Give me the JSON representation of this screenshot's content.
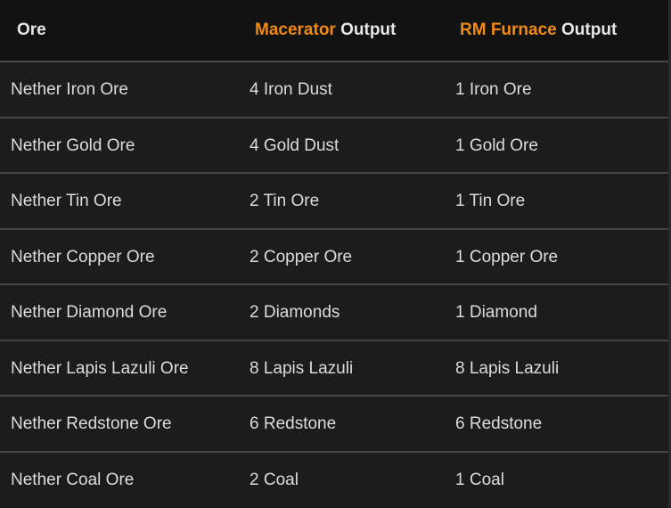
{
  "header": {
    "col1": "Ore",
    "col2_accent": "Macerator",
    "col2_rest": " Output",
    "col3_accent": "RM Furnace",
    "col3_rest": " Output"
  },
  "rows": [
    {
      "ore": "Nether Iron Ore",
      "macerator": "4 Iron Dust",
      "furnace": "1 Iron Ore"
    },
    {
      "ore": "Nether Gold Ore",
      "macerator": "4 Gold Dust",
      "furnace": "1 Gold Ore"
    },
    {
      "ore": "Nether Tin Ore",
      "macerator": "2 Tin Ore",
      "furnace": "1 Tin Ore"
    },
    {
      "ore": "Nether Copper Ore",
      "macerator": "2 Copper Ore",
      "furnace": "1 Copper Ore"
    },
    {
      "ore": "Nether Diamond Ore",
      "macerator": "2 Diamonds",
      "furnace": "1 Diamond"
    },
    {
      "ore": "Nether Lapis Lazuli Ore",
      "macerator": "8 Lapis Lazuli",
      "furnace": "8 Lapis Lazuli"
    },
    {
      "ore": "Nether Redstone Ore",
      "macerator": "6 Redstone",
      "furnace": "6 Redstone"
    },
    {
      "ore": "Nether Coal Ore",
      "macerator": "2 Coal",
      "furnace": "1 Coal"
    }
  ],
  "colors": {
    "accent": "#f08a12",
    "header_bg": "#121212",
    "row_bg": "#1c1c1c",
    "text": "#dcdcdc"
  }
}
